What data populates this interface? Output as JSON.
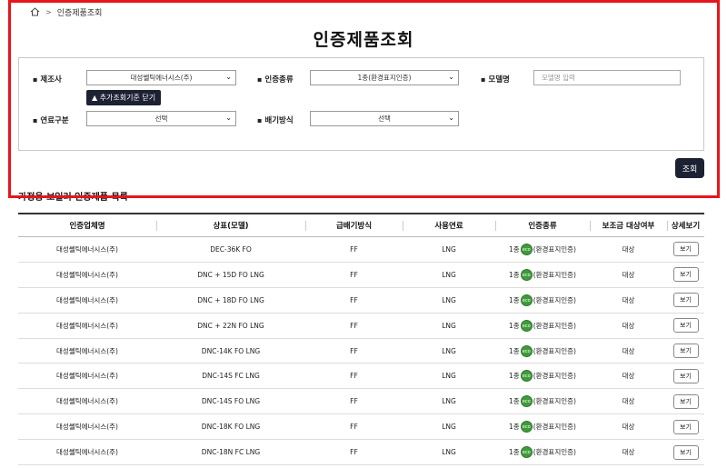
{
  "breadcrumb": {
    "current": "인증제품조회"
  },
  "page_title": "인증제품조회",
  "filters": {
    "maker_label": "제조사",
    "maker_value": "대성쎌틱에너시스(주)",
    "cert_type_label": "인증종류",
    "cert_type_value": "1종(환경표지인증)",
    "model_label": "모델명",
    "model_placeholder": "모델명 입력",
    "toggle_label": "▲ 추가조회기준 닫기",
    "fuel_label": "연료구분",
    "fuel_value": "선택",
    "exhaust_label": "배기방식",
    "exhaust_value": "선택"
  },
  "search_button": "조회",
  "list_title": "가정용 보일러 인증제품 목록",
  "table": {
    "headers": [
      "인증업체명",
      "상표(모델)",
      "급배기방식",
      "사용연료",
      "인증종류",
      "보조금 대상여부",
      "상세보기"
    ],
    "rows": [
      {
        "company": "대성쎌틱에너시스(주)",
        "model": "DEC-36K FO",
        "exhaust": "FF",
        "fuel": "LNG",
        "cert_prefix": "1종",
        "cert_name": "(환경표지인증)",
        "subsidy": "대상",
        "view": "보기"
      },
      {
        "company": "대성쎌틱에너시스(주)",
        "model": "DNC + 15D FO LNG",
        "exhaust": "FF",
        "fuel": "LNG",
        "cert_prefix": "1종",
        "cert_name": "(환경표지인증)",
        "subsidy": "대상",
        "view": "보기"
      },
      {
        "company": "대성쎌틱에너시스(주)",
        "model": "DNC + 18D FO LNG",
        "exhaust": "FF",
        "fuel": "LNG",
        "cert_prefix": "1종",
        "cert_name": "(환경표지인증)",
        "subsidy": "대상",
        "view": "보기"
      },
      {
        "company": "대성쎌틱에너시스(주)",
        "model": "DNC + 22N FO LNG",
        "exhaust": "FF",
        "fuel": "LNG",
        "cert_prefix": "1종",
        "cert_name": "(환경표지인증)",
        "subsidy": "대상",
        "view": "보기"
      },
      {
        "company": "대성쎌틱에너시스(주)",
        "model": "DNC-14K FO LNG",
        "exhaust": "FF",
        "fuel": "LNG",
        "cert_prefix": "1종",
        "cert_name": "(환경표지인증)",
        "subsidy": "대상",
        "view": "보기"
      },
      {
        "company": "대성쎌틱에너시스(주)",
        "model": "DNC-14S FC LNG",
        "exhaust": "FF",
        "fuel": "LNG",
        "cert_prefix": "1종",
        "cert_name": "(환경표지인증)",
        "subsidy": "대상",
        "view": "보기"
      },
      {
        "company": "대성쎌틱에너시스(주)",
        "model": "DNC-14S FO LNG",
        "exhaust": "FF",
        "fuel": "LNG",
        "cert_prefix": "1종",
        "cert_name": "(환경표지인증)",
        "subsidy": "대상",
        "view": "보기"
      },
      {
        "company": "대성쎌틱에너시스(주)",
        "model": "DNC-18K FO LNG",
        "exhaust": "FF",
        "fuel": "LNG",
        "cert_prefix": "1종",
        "cert_name": "(환경표지인증)",
        "subsidy": "대상",
        "view": "보기"
      },
      {
        "company": "대성쎌틱에너시스(주)",
        "model": "DNC-18N FC LNG",
        "exhaust": "FF",
        "fuel": "LNG",
        "cert_prefix": "1종",
        "cert_name": "(환경표지인증)",
        "subsidy": "대상",
        "view": "보기"
      }
    ]
  },
  "colors": {
    "highlight": "#e8141c",
    "button_bg": "#1c2233",
    "cert_icon": "#3f9a3a"
  }
}
